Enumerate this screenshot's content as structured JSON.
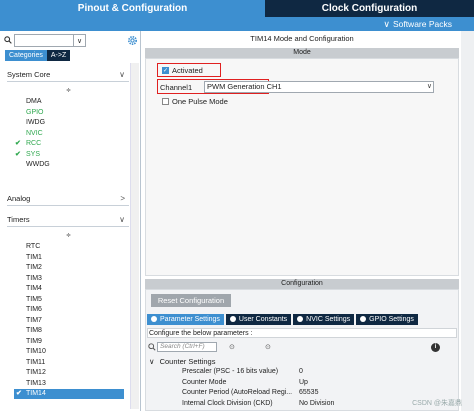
{
  "tabs": {
    "pinout": "Pinout & Configuration",
    "clock": "Clock Configuration"
  },
  "software_packs": {
    "label": "Software Packs",
    "chevron": "∨"
  },
  "left": {
    "search_dropdown": "∨",
    "category_tabs": [
      "Categories",
      "A->Z"
    ],
    "sections": {
      "system_core": "System Core",
      "analog": "Analog",
      "timers": "Timers",
      "chevron": ">",
      "chevron_open": "∨"
    },
    "sort_mark": "≑",
    "system_core_items": [
      {
        "label": "DMA",
        "color": "#1e1e1e",
        "checked": false
      },
      {
        "label": "GPIO",
        "color": "#2fa84f",
        "checked": false
      },
      {
        "label": "IWDG",
        "color": "#1e1e1e",
        "checked": false
      },
      {
        "label": "NVIC",
        "color": "#2fa84f",
        "checked": false
      },
      {
        "label": "RCC",
        "color": "#2fa84f",
        "checked": true
      },
      {
        "label": "SYS",
        "color": "#2fa84f",
        "checked": true
      },
      {
        "label": "WWDG",
        "color": "#1e1e1e",
        "checked": false
      }
    ],
    "check_mark": "✔",
    "timer_items": [
      "RTC",
      "TIM1",
      "TIM2",
      "TIM3",
      "TIM4",
      "TIM5",
      "TIM6",
      "TIM7",
      "TIM8",
      "TIM9",
      "TIM10",
      "TIM11",
      "TIM12",
      "TIM13"
    ],
    "selected_item": "TIM14"
  },
  "mode": {
    "title": "TIM14 Mode and Configuration",
    "header": "Mode",
    "activated_label": "Activated",
    "activated_checked": true,
    "channel_label": "Channel1",
    "channel_value": "PWM Generation CH1",
    "one_pulse_label": "One Pulse Mode",
    "one_pulse_checked": false,
    "dropdown_glyph": "∨"
  },
  "config": {
    "header": "Configuration",
    "reset_button": "Reset Configuration",
    "param_tabs": [
      "Parameter Settings",
      "User Constants",
      "NVIC Settings",
      "GPIO Settings"
    ],
    "hint": "Configure the below parameters :",
    "search_placeholder": "Search (Ctrl+F)",
    "group_label": "Counter Settings",
    "group_chevron": "∨",
    "nav_glyphs": [
      "⊙",
      "⊙"
    ],
    "info_glyph": "i",
    "params": [
      {
        "name": "Prescaler (PSC - 16 bits value)",
        "value": "0"
      },
      {
        "name": "Counter Mode",
        "value": "Up"
      },
      {
        "name": "Counter Period (AutoReload Regi...",
        "value": "65535"
      },
      {
        "name": "Internal Clock Division (CKD)",
        "value": "No Division"
      }
    ]
  },
  "watermark": "CSDN @朱嘉鼎",
  "colors": {
    "accent": "#3d8fd0",
    "dark": "#0f2842",
    "highlight_red": "#e02020",
    "enabled_green": "#2fa84f"
  }
}
